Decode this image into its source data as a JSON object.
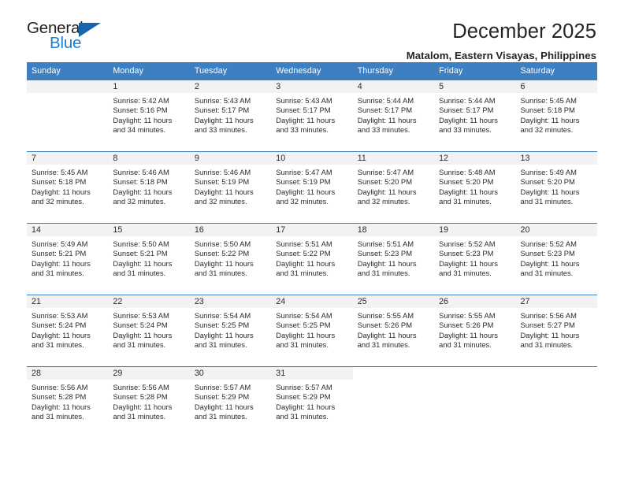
{
  "brand": {
    "name_top": "General",
    "name_bottom": "Blue",
    "accent_color": "#1a7fd4",
    "triangle_color": "#1565b0"
  },
  "header": {
    "title": "December 2025",
    "subtitle": "Matalom, Eastern Visayas, Philippines"
  },
  "calendar": {
    "header_color": "#3d7fc1",
    "daynum_band_color": "#f2f2f2",
    "weekdays": [
      "Sunday",
      "Monday",
      "Tuesday",
      "Wednesday",
      "Thursday",
      "Friday",
      "Saturday"
    ],
    "weeks": [
      [
        {
          "day": "",
          "lines": []
        },
        {
          "day": "1",
          "lines": [
            "Sunrise: 5:42 AM",
            "Sunset: 5:16 PM",
            "Daylight: 11 hours",
            "and 34 minutes."
          ]
        },
        {
          "day": "2",
          "lines": [
            "Sunrise: 5:43 AM",
            "Sunset: 5:17 PM",
            "Daylight: 11 hours",
            "and 33 minutes."
          ]
        },
        {
          "day": "3",
          "lines": [
            "Sunrise: 5:43 AM",
            "Sunset: 5:17 PM",
            "Daylight: 11 hours",
            "and 33 minutes."
          ]
        },
        {
          "day": "4",
          "lines": [
            "Sunrise: 5:44 AM",
            "Sunset: 5:17 PM",
            "Daylight: 11 hours",
            "and 33 minutes."
          ]
        },
        {
          "day": "5",
          "lines": [
            "Sunrise: 5:44 AM",
            "Sunset: 5:17 PM",
            "Daylight: 11 hours",
            "and 33 minutes."
          ]
        },
        {
          "day": "6",
          "lines": [
            "Sunrise: 5:45 AM",
            "Sunset: 5:18 PM",
            "Daylight: 11 hours",
            "and 32 minutes."
          ]
        }
      ],
      [
        {
          "day": "7",
          "lines": [
            "Sunrise: 5:45 AM",
            "Sunset: 5:18 PM",
            "Daylight: 11 hours",
            "and 32 minutes."
          ]
        },
        {
          "day": "8",
          "lines": [
            "Sunrise: 5:46 AM",
            "Sunset: 5:18 PM",
            "Daylight: 11 hours",
            "and 32 minutes."
          ]
        },
        {
          "day": "9",
          "lines": [
            "Sunrise: 5:46 AM",
            "Sunset: 5:19 PM",
            "Daylight: 11 hours",
            "and 32 minutes."
          ]
        },
        {
          "day": "10",
          "lines": [
            "Sunrise: 5:47 AM",
            "Sunset: 5:19 PM",
            "Daylight: 11 hours",
            "and 32 minutes."
          ]
        },
        {
          "day": "11",
          "lines": [
            "Sunrise: 5:47 AM",
            "Sunset: 5:20 PM",
            "Daylight: 11 hours",
            "and 32 minutes."
          ]
        },
        {
          "day": "12",
          "lines": [
            "Sunrise: 5:48 AM",
            "Sunset: 5:20 PM",
            "Daylight: 11 hours",
            "and 31 minutes."
          ]
        },
        {
          "day": "13",
          "lines": [
            "Sunrise: 5:49 AM",
            "Sunset: 5:20 PM",
            "Daylight: 11 hours",
            "and 31 minutes."
          ]
        }
      ],
      [
        {
          "day": "14",
          "lines": [
            "Sunrise: 5:49 AM",
            "Sunset: 5:21 PM",
            "Daylight: 11 hours",
            "and 31 minutes."
          ]
        },
        {
          "day": "15",
          "lines": [
            "Sunrise: 5:50 AM",
            "Sunset: 5:21 PM",
            "Daylight: 11 hours",
            "and 31 minutes."
          ]
        },
        {
          "day": "16",
          "lines": [
            "Sunrise: 5:50 AM",
            "Sunset: 5:22 PM",
            "Daylight: 11 hours",
            "and 31 minutes."
          ]
        },
        {
          "day": "17",
          "lines": [
            "Sunrise: 5:51 AM",
            "Sunset: 5:22 PM",
            "Daylight: 11 hours",
            "and 31 minutes."
          ]
        },
        {
          "day": "18",
          "lines": [
            "Sunrise: 5:51 AM",
            "Sunset: 5:23 PM",
            "Daylight: 11 hours",
            "and 31 minutes."
          ]
        },
        {
          "day": "19",
          "lines": [
            "Sunrise: 5:52 AM",
            "Sunset: 5:23 PM",
            "Daylight: 11 hours",
            "and 31 minutes."
          ]
        },
        {
          "day": "20",
          "lines": [
            "Sunrise: 5:52 AM",
            "Sunset: 5:23 PM",
            "Daylight: 11 hours",
            "and 31 minutes."
          ]
        }
      ],
      [
        {
          "day": "21",
          "lines": [
            "Sunrise: 5:53 AM",
            "Sunset: 5:24 PM",
            "Daylight: 11 hours",
            "and 31 minutes."
          ]
        },
        {
          "day": "22",
          "lines": [
            "Sunrise: 5:53 AM",
            "Sunset: 5:24 PM",
            "Daylight: 11 hours",
            "and 31 minutes."
          ]
        },
        {
          "day": "23",
          "lines": [
            "Sunrise: 5:54 AM",
            "Sunset: 5:25 PM",
            "Daylight: 11 hours",
            "and 31 minutes."
          ]
        },
        {
          "day": "24",
          "lines": [
            "Sunrise: 5:54 AM",
            "Sunset: 5:25 PM",
            "Daylight: 11 hours",
            "and 31 minutes."
          ]
        },
        {
          "day": "25",
          "lines": [
            "Sunrise: 5:55 AM",
            "Sunset: 5:26 PM",
            "Daylight: 11 hours",
            "and 31 minutes."
          ]
        },
        {
          "day": "26",
          "lines": [
            "Sunrise: 5:55 AM",
            "Sunset: 5:26 PM",
            "Daylight: 11 hours",
            "and 31 minutes."
          ]
        },
        {
          "day": "27",
          "lines": [
            "Sunrise: 5:56 AM",
            "Sunset: 5:27 PM",
            "Daylight: 11 hours",
            "and 31 minutes."
          ]
        }
      ],
      [
        {
          "day": "28",
          "lines": [
            "Sunrise: 5:56 AM",
            "Sunset: 5:28 PM",
            "Daylight: 11 hours",
            "and 31 minutes."
          ]
        },
        {
          "day": "29",
          "lines": [
            "Sunrise: 5:56 AM",
            "Sunset: 5:28 PM",
            "Daylight: 11 hours",
            "and 31 minutes."
          ]
        },
        {
          "day": "30",
          "lines": [
            "Sunrise: 5:57 AM",
            "Sunset: 5:29 PM",
            "Daylight: 11 hours",
            "and 31 minutes."
          ]
        },
        {
          "day": "31",
          "lines": [
            "Sunrise: 5:57 AM",
            "Sunset: 5:29 PM",
            "Daylight: 11 hours",
            "and 31 minutes."
          ]
        },
        {
          "day": "",
          "lines": [],
          "blank": true
        },
        {
          "day": "",
          "lines": [],
          "blank": true
        },
        {
          "day": "",
          "lines": [],
          "blank": true
        }
      ]
    ]
  }
}
